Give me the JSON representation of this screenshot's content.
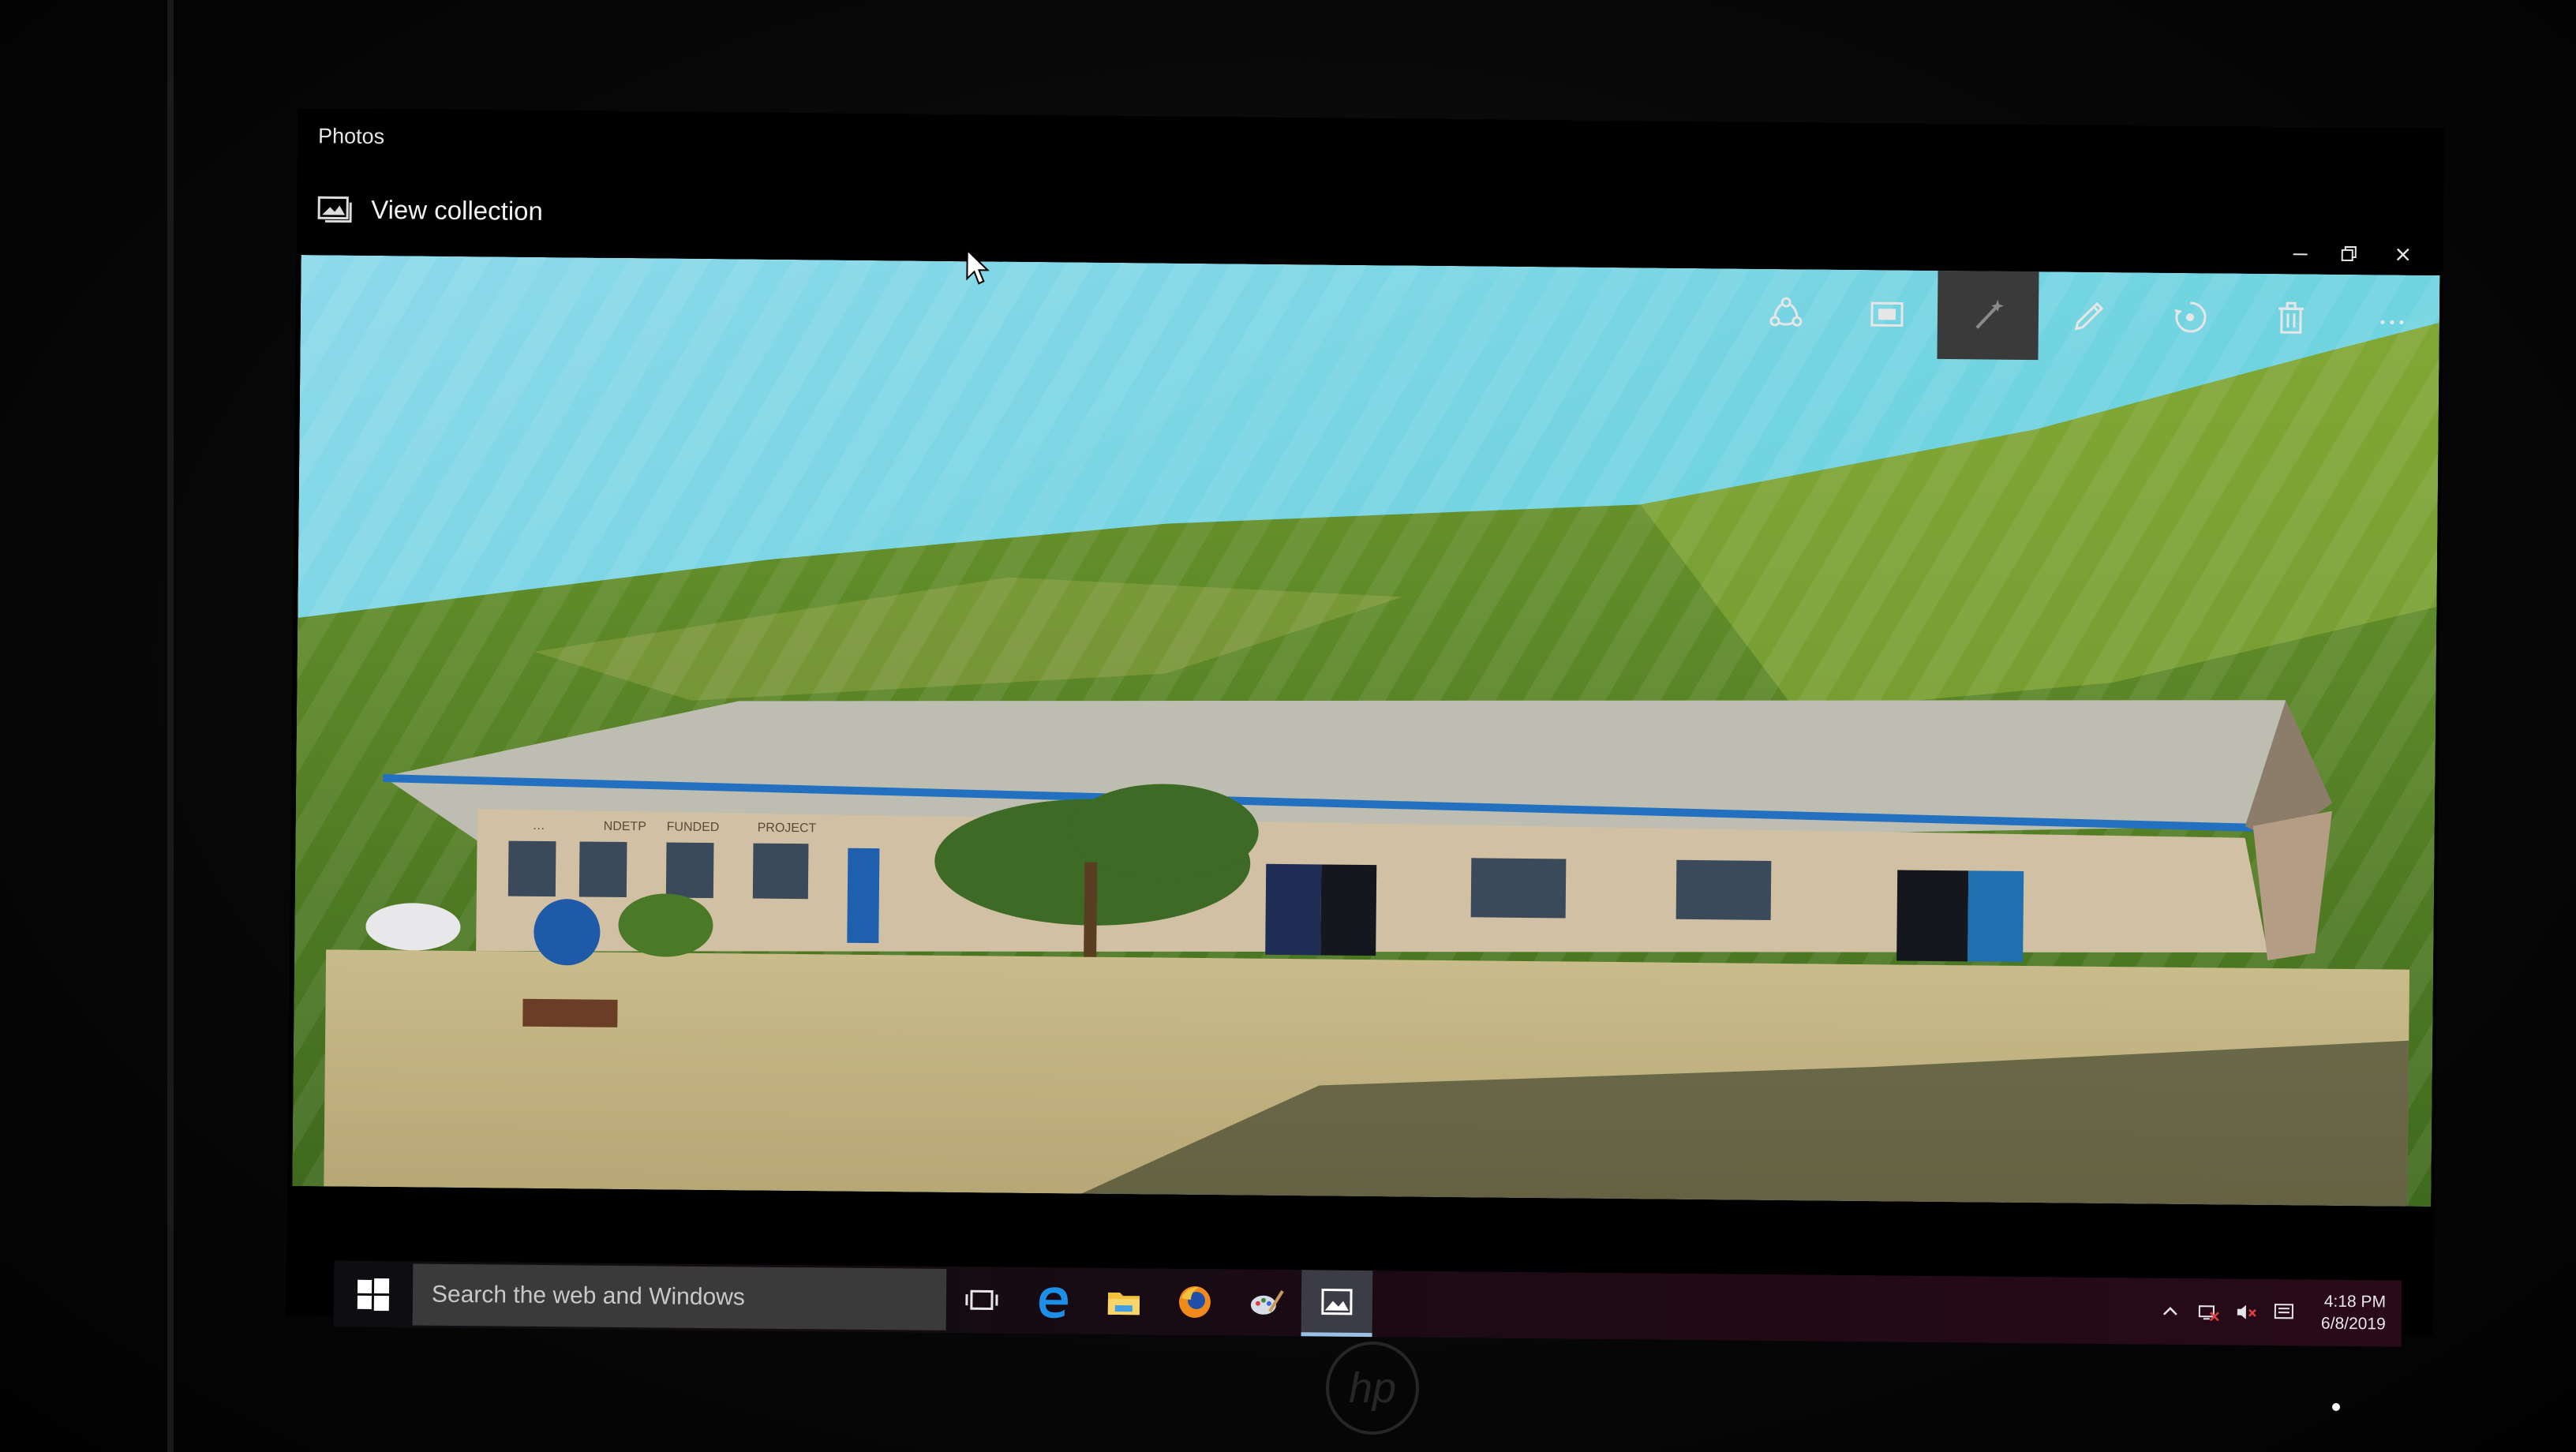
{
  "app": {
    "title": "Photos"
  },
  "header": {
    "collection_label": "View collection",
    "collection_icon": "gallery-icon"
  },
  "toolbar": [
    {
      "name": "share-icon",
      "label": "Share"
    },
    {
      "name": "slideshow-icon",
      "label": "Slideshow"
    },
    {
      "name": "enhance-icon",
      "label": "Enhance",
      "active": true
    },
    {
      "name": "edit-pencil-icon",
      "label": "Edit"
    },
    {
      "name": "rotate-icon",
      "label": "Rotate"
    },
    {
      "name": "trash-icon",
      "label": "Delete"
    },
    {
      "name": "more-icon",
      "label": "More"
    }
  ],
  "photo": {
    "roof_signs": [
      "…",
      "NDETP",
      "FUNDED",
      "PROJECT"
    ]
  },
  "taskbar": {
    "search_placeholder": "Search the web and Windows",
    "pinned": [
      "task-view-icon",
      "edge-icon",
      "file-explorer-icon",
      "firefox-icon",
      "paint-app-icon",
      "photos-app-icon"
    ],
    "tray_icons": [
      "chevron-up-icon",
      "network-icon",
      "volume-icon",
      "notification-icon"
    ],
    "clock_time": "4:18 PM",
    "clock_date": "6/8/2019"
  },
  "colors": {
    "taskbar_accent": "#290a18",
    "sky": "#7fd6e6",
    "roof": "#b9b9ad",
    "trim_blue": "#2470c0"
  }
}
